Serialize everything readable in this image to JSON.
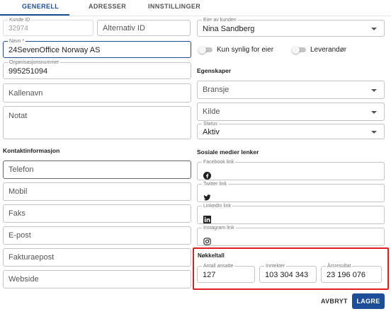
{
  "tabs": [
    {
      "label": "GENERELL",
      "active": true
    },
    {
      "label": "ADRESSER",
      "active": false
    },
    {
      "label": "INNSTILLINGER",
      "active": false
    }
  ],
  "left": {
    "customer_id": {
      "label": "Kunde ID",
      "value": "32974"
    },
    "alt_id": {
      "placeholder": "Alternativ ID"
    },
    "name": {
      "label": "Navn *",
      "value": "24SevenOffice Norway AS"
    },
    "org_number": {
      "label": "Organisasjonsnummer",
      "value": "995251094"
    },
    "nickname": {
      "placeholder": "Kallenavn"
    },
    "note": {
      "placeholder": "Notat"
    },
    "contact_heading": "Kontaktinformasjon",
    "contact_fields": [
      "Telefon",
      "Mobil",
      "Faks",
      "E-post",
      "Fakturaepost",
      "Webside"
    ]
  },
  "right": {
    "owner": {
      "label": "Eier av kunden",
      "value": "Nina Sandberg"
    },
    "switch_owner_only": {
      "label": "Kun synlig for eier",
      "on": false
    },
    "switch_supplier": {
      "label": "Leverandør",
      "on": false
    },
    "properties_heading": "Egenskaper",
    "industry": {
      "placeholder": "Bransje"
    },
    "source": {
      "placeholder": "Kilde"
    },
    "status": {
      "label": "Status",
      "value": "Aktiv"
    },
    "social_heading": "Sosiale medier lenker",
    "social": [
      {
        "label": "Facebook link",
        "icon": "facebook-icon"
      },
      {
        "label": "Twitter link",
        "icon": "twitter-icon"
      },
      {
        "label": "LinkedIn link",
        "icon": "linkedin-icon"
      },
      {
        "label": "Instagram link",
        "icon": "instagram-icon"
      }
    ],
    "key_figures": {
      "heading": "Nøkkeltall",
      "employees": {
        "label": "Antall ansatte",
        "value": "127"
      },
      "income": {
        "label": "Inntekter",
        "value": "103 304 343"
      },
      "annual_result": {
        "label": "Årsresultat",
        "value": "23 196 076"
      }
    }
  },
  "actions": {
    "cancel": "AVBRYT",
    "save": "LAGRE"
  },
  "colors": {
    "primary": "#1f4e99",
    "highlight": "#e01e1e"
  }
}
